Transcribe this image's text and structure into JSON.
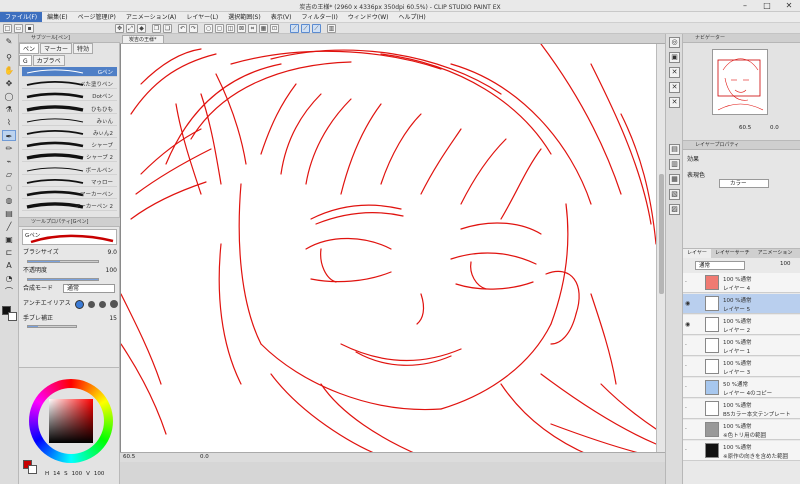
{
  "window": {
    "title": "炭吉の王様* (2960 x 4336px 350dpi 60.5%) - CLIP STUDIO PAINT EX"
  },
  "menu": [
    "ファイル(F)",
    "編集(E)",
    "ページ管理(P)",
    "アニメーション(A)",
    "レイヤー(L)",
    "選択範囲(S)",
    "表示(V)",
    "フィルター(I)",
    "ウィンドウ(W)",
    "ヘルプ(H)"
  ],
  "subtool": {
    "panel_title": "サブツール[ペン]",
    "tabs": [
      "ペン",
      "マーカー",
      "特効"
    ],
    "tab2": [
      "G",
      "カブラペ"
    ],
    "brushes": [
      "Gペン",
      "べた塗りペン",
      "Dotペン",
      "ひもひも",
      "みぃん",
      "みぃん2",
      "シャープ",
      "シャープ 2",
      "ボールペン",
      "マゥロー",
      "マーカーペン",
      "マーカーペン 2"
    ]
  },
  "toolprop": {
    "panel_title": "ツールプロパティ[Gペン]",
    "brush_name": "Gペン",
    "brush_size_label": "ブラシサイズ",
    "brush_size": "9.0",
    "opacity_label": "不透明度",
    "opacity": "100",
    "blend_label": "合成モード",
    "blend_value": "通常",
    "aa_label": "アンチエイリアス",
    "stab_label": "手ブレ補正",
    "stab_value": "15"
  },
  "color": {
    "hsv": [
      "H",
      "S",
      "V"
    ],
    "vals": [
      "14",
      "100",
      "100"
    ],
    "main": "#c70000",
    "sub": "#ffffff"
  },
  "canvas": {
    "doc_tab": "炭吉の王様*"
  },
  "status": {
    "zoom": "60.5",
    "angle": "0.0"
  },
  "navigator": {
    "title": "ナビゲーター",
    "zoom": "60.5",
    "angle": "0.0"
  },
  "layerprop": {
    "title": "レイヤープロパティ",
    "effect": "効果",
    "expr": "表現色",
    "expr_value": "カラー"
  },
  "layers": {
    "tabs": [
      "レイヤー",
      "レイヤーサーチ",
      "アニメーション"
    ],
    "blend": "通常",
    "opacity": "100",
    "items": [
      {
        "top": "100 %通常",
        "name": "レイヤー 4"
      },
      {
        "top": "100 %通常",
        "name": "レイヤー 5"
      },
      {
        "top": "100 %通常",
        "name": "レイヤー 2"
      },
      {
        "top": "100 %通常",
        "name": "レイヤー 1"
      },
      {
        "top": "100 %通常",
        "name": "レイヤー 3"
      },
      {
        "top": "50 %通常",
        "name": "レイヤー 4のコピー"
      },
      {
        "top": "100 %通常",
        "name": "B5カラー本文テンプレート"
      },
      {
        "top": "100 %通常",
        "name": "※色トリ用の範囲"
      },
      {
        "top": "100 %通常",
        "name": "※原作の向きを含めた範囲"
      }
    ]
  },
  "colors": {
    "accent": "#4f7fc6",
    "stroke": "#e0130f",
    "menu_active": "#3d6fbf"
  }
}
